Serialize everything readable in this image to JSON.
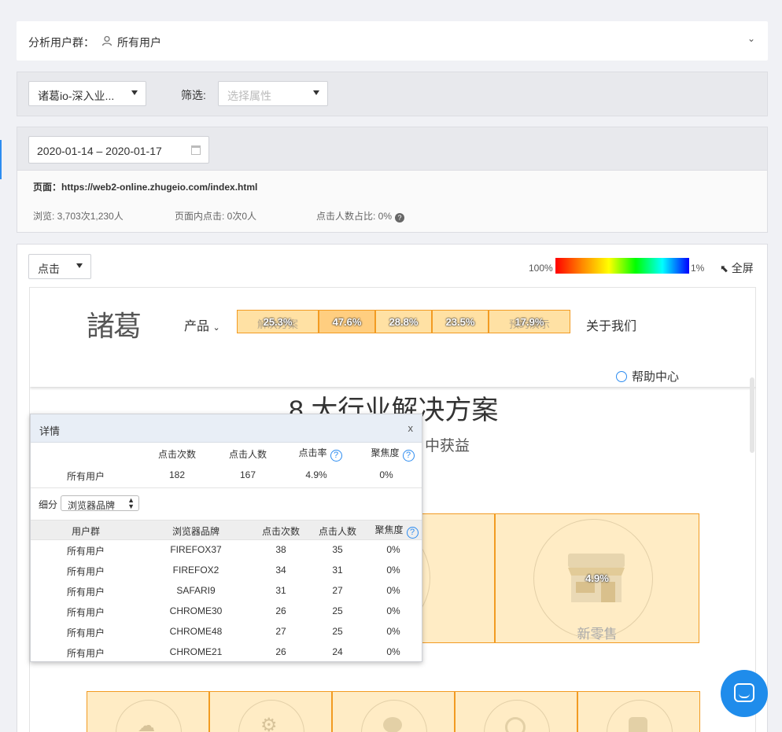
{
  "segment": {
    "label": "分析用户群：",
    "value": "所有用户"
  },
  "filter": {
    "app_select": "诸葛io-深入业...",
    "filter_label": "筛选:",
    "attr_placeholder": "选择属性"
  },
  "date": {
    "range": "2020-01-14 – 2020-01-17"
  },
  "page": {
    "label": "页面：",
    "url": "https://web2-online.zhugeio.com/index.html"
  },
  "stats": {
    "views": "浏览: 3,703次1,230人",
    "clicks": "页面内点击: 0次0人",
    "ratio": "点击人数占比: 0%"
  },
  "heatmap": {
    "mode": "点击",
    "legend_max": "100%",
    "legend_min": "1%",
    "fullscreen": "全屏"
  },
  "site": {
    "logo": "諸葛",
    "product": "产品",
    "nav_boxes": [
      {
        "under": "解决方案",
        "pct": "25.3%"
      },
      {
        "under": "",
        "pct": "47.6%"
      },
      {
        "under": "",
        "pct": "28.8%"
      },
      {
        "under": "",
        "pct": "23.5%"
      },
      {
        "under": "预约演示",
        "pct": "17.9%"
      }
    ],
    "about": "关于我们",
    "help": "帮助中心",
    "title": "8 大行业解决方案",
    "subtitle": "中获益",
    "retail_pct": "4.9%",
    "retail_name": "新零售"
  },
  "panel": {
    "title": "详情",
    "close": "x",
    "summary_headers": [
      "点击次数",
      "点击人数",
      "点击率",
      "聚焦度"
    ],
    "summary_row": {
      "group": "所有用户",
      "values": [
        "182",
        "167",
        "4.9%",
        "0%"
      ]
    },
    "breakdown_label": "细分",
    "breakdown_value": "浏览器品牌",
    "detail_headers": [
      "用户群",
      "浏览器品牌",
      "点击次数",
      "点击人数",
      "聚焦度"
    ],
    "rows": [
      [
        "所有用户",
        "FIREFOX37",
        "38",
        "35",
        "0%"
      ],
      [
        "所有用户",
        "FIREFOX2",
        "34",
        "31",
        "0%"
      ],
      [
        "所有用户",
        "SAFARI9",
        "31",
        "27",
        "0%"
      ],
      [
        "所有用户",
        "CHROME30",
        "26",
        "25",
        "0%"
      ],
      [
        "所有用户",
        "CHROME48",
        "27",
        "25",
        "0%"
      ],
      [
        "所有用户",
        "CHROME21",
        "26",
        "24",
        "0%"
      ]
    ]
  }
}
